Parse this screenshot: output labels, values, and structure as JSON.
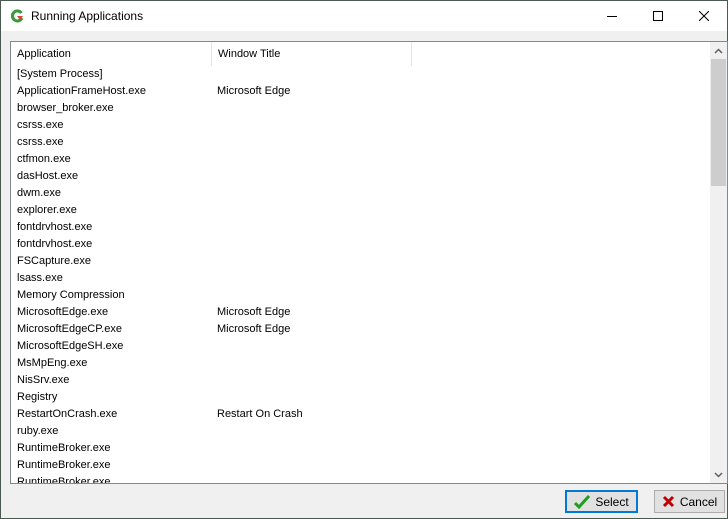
{
  "window": {
    "title": "Running Applications",
    "icon": "refresh-app-icon",
    "controls": [
      "minimize-icon",
      "maximize-icon",
      "close-icon"
    ]
  },
  "list": {
    "columns": [
      "Application",
      "Window Title"
    ],
    "rows": [
      {
        "app": "[System Process]",
        "title": ""
      },
      {
        "app": "ApplicationFrameHost.exe",
        "title": "Microsoft Edge"
      },
      {
        "app": "browser_broker.exe",
        "title": ""
      },
      {
        "app": "csrss.exe",
        "title": ""
      },
      {
        "app": "csrss.exe",
        "title": ""
      },
      {
        "app": "ctfmon.exe",
        "title": ""
      },
      {
        "app": "dasHost.exe",
        "title": ""
      },
      {
        "app": "dwm.exe",
        "title": ""
      },
      {
        "app": "explorer.exe",
        "title": ""
      },
      {
        "app": "fontdrvhost.exe",
        "title": ""
      },
      {
        "app": "fontdrvhost.exe",
        "title": ""
      },
      {
        "app": "FSCapture.exe",
        "title": ""
      },
      {
        "app": "lsass.exe",
        "title": ""
      },
      {
        "app": "Memory Compression",
        "title": ""
      },
      {
        "app": "MicrosoftEdge.exe",
        "title": "Microsoft Edge"
      },
      {
        "app": "MicrosoftEdgeCP.exe",
        "title": "Microsoft Edge"
      },
      {
        "app": "MicrosoftEdgeSH.exe",
        "title": ""
      },
      {
        "app": "MsMpEng.exe",
        "title": ""
      },
      {
        "app": "NisSrv.exe",
        "title": ""
      },
      {
        "app": "Registry",
        "title": ""
      },
      {
        "app": "RestartOnCrash.exe",
        "title": "Restart On Crash"
      },
      {
        "app": "ruby.exe",
        "title": ""
      },
      {
        "app": "RuntimeBroker.exe",
        "title": ""
      },
      {
        "app": "RuntimeBroker.exe",
        "title": ""
      },
      {
        "app": "RuntimeBroker.exe",
        "title": ""
      }
    ]
  },
  "buttons": {
    "select": "Select",
    "cancel": "Cancel"
  },
  "colors": {
    "accent": "#0078d7",
    "check_green": "#1e9e1e",
    "cancel_red": "#c00000"
  }
}
